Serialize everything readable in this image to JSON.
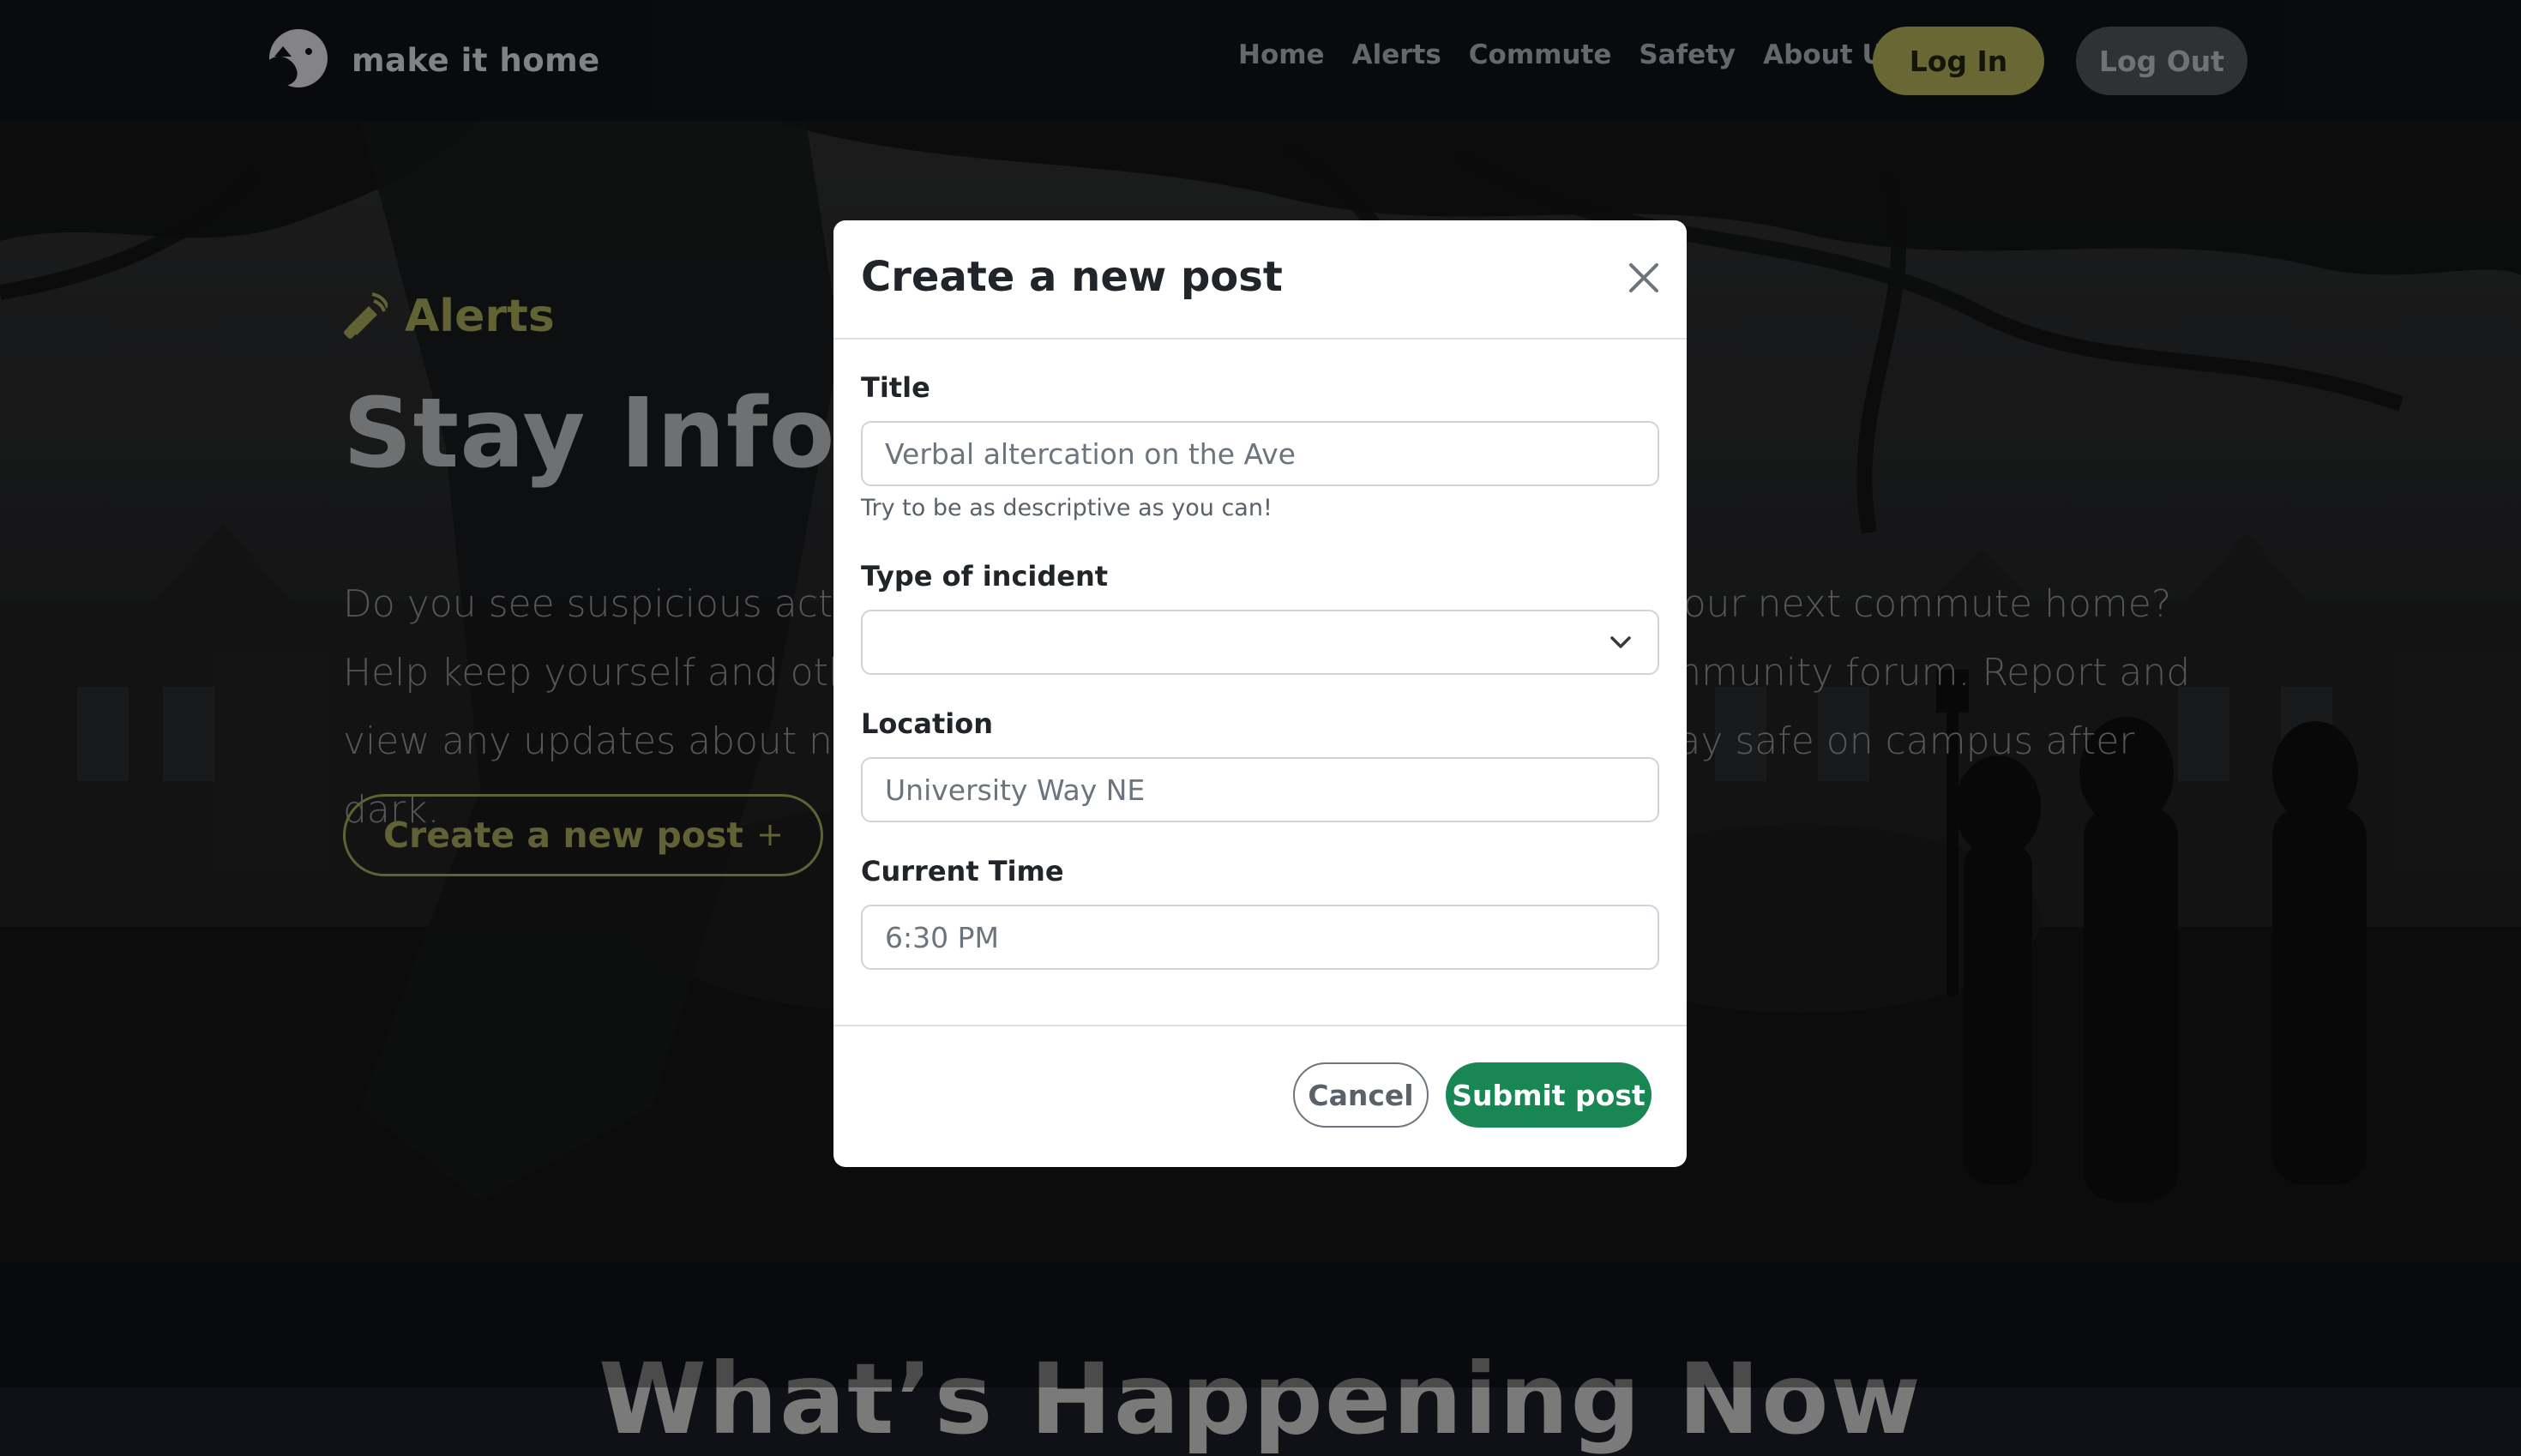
{
  "nav": {
    "brand": "make it home",
    "links": [
      "Home",
      "Alerts",
      "Commute",
      "Safety",
      "About Us"
    ],
    "login_label": "Log In",
    "logout_label": "Log Out"
  },
  "hero": {
    "tag": "Alerts",
    "title": "Stay Informed",
    "description": "Do you see suspicious activity on your way to class or while planning your next commute home? Help keep yourself and others safe by sharing what you see on our community forum. Report and view any updates about non-life threatening incidents so others can stay safe on campus after dark.",
    "create_label": "Create a new post",
    "create_icon": "plus-icon"
  },
  "section": {
    "title": "What’s Happening Now"
  },
  "modal": {
    "title": "Create a new post",
    "fields": {
      "title_label": "Title",
      "title_placeholder": "Verbal altercation on the Ave",
      "title_help": "Try to be as descriptive as you can!",
      "type_label": "Type of incident",
      "type_value": "",
      "location_label": "Location",
      "location_placeholder": "University Way NE",
      "time_label": "Current Time",
      "time_placeholder": "6:30 PM"
    },
    "cancel_label": "Cancel",
    "submit_label": "Submit post"
  },
  "colors": {
    "accent": "#aaa956",
    "success": "#198754",
    "nav_bg": "#0f1116"
  }
}
